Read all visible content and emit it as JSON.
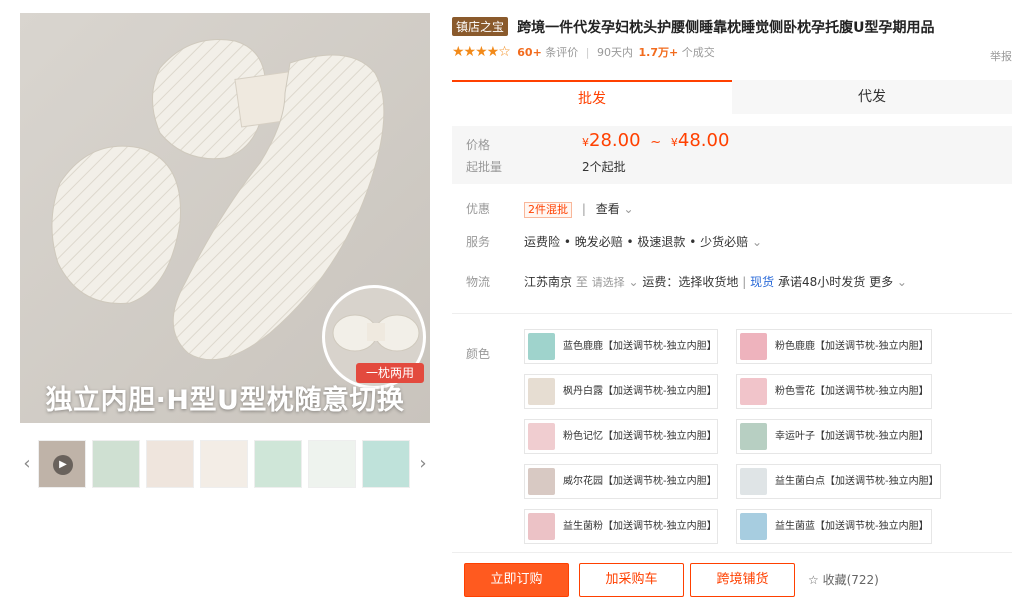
{
  "gallery": {
    "inset_label": "一枕两用",
    "caption": "独立内胆·H型U型枕随意切换",
    "thumbnails": [
      {
        "icon": "video-thumbnail",
        "color": "#bfb3a8"
      },
      {
        "icon": "pillow-thumbnail",
        "color": "#cfe0d2"
      },
      {
        "icon": "pillow-thumbnail",
        "color": "#efe5dd"
      },
      {
        "icon": "pillow-thumbnail",
        "color": "#f3ede6"
      },
      {
        "icon": "pillow-thumbnail",
        "color": "#cfe6d8"
      },
      {
        "icon": "pillow-thumbnail",
        "color": "#eef3ee"
      },
      {
        "icon": "pillow-thumbnail",
        "color": "#bfe2da"
      }
    ]
  },
  "product": {
    "shop_badge": "镇店之宝",
    "title": "跨境一件代发孕妇枕头护腰侧睡靠枕睡觉侧卧枕孕托腹U型孕期用品",
    "rating": {
      "stars": "★★★★☆",
      "reviews_count": "60+",
      "reviews_label": "条评价",
      "period_label": "90天内",
      "sold_count": "1.7万+",
      "sold_label": "个成交"
    },
    "report": "举报"
  },
  "tabs": [
    {
      "label": "批发",
      "active": true
    },
    {
      "label": "代发",
      "active": false
    }
  ],
  "price": {
    "price_label": "价格",
    "currency": "¥",
    "min": "28.00",
    "tilde": "~",
    "max": "48.00",
    "moq_label": "起批量",
    "moq": "2个起批"
  },
  "promo": {
    "label": "优惠",
    "tag": "2件混批",
    "link": "查看"
  },
  "service": {
    "label": "服务",
    "text": "运费险 • 晚发必赔 • 极速退款 • 少货必赔"
  },
  "logistics": {
    "label": "物流",
    "origin": "江苏南京",
    "to": "至",
    "select": "请选择",
    "freight": "运费：选择收货地",
    "stock": "现货",
    "promise": "承诺48小时发货",
    "more": "更多"
  },
  "colors": {
    "label": "颜色",
    "items": [
      {
        "name": "蓝色鹿鹿【加送调节枕-独立内胆】",
        "color": "#9fd3cc"
      },
      {
        "name": "粉色鹿鹿【加送调节枕-独立内胆】",
        "color": "#eeb3bd"
      },
      {
        "name": "枫丹白露【加送调节枕-独立内胆】",
        "color": "#e6ddd2"
      },
      {
        "name": "粉色雪花【加送调节枕-独立内胆】",
        "color": "#f1c4ca"
      },
      {
        "name": "粉色记忆【加送调节枕-独立内胆】",
        "color": "#f0cdd0"
      },
      {
        "name": "幸运叶子【加送调节枕-独立内胆】",
        "color": "#b7cfc2"
      },
      {
        "name": "威尔花园【加送调节枕-独立内胆】",
        "color": "#d8c9c3"
      },
      {
        "name": "益生菌白点【加送调节枕-独立内胆】",
        "color": "#dfe4e6"
      },
      {
        "name": "益生菌粉【加送调节枕-独立内胆】",
        "color": "#ecc2c6"
      },
      {
        "name": "益生菌蓝【加送调节枕-独立内胆】",
        "color": "#a7cde0"
      }
    ]
  },
  "actions": {
    "buy_now": "立即订购",
    "add_cart": "加采购车",
    "cross_border": "跨境铺货",
    "favorite": "收藏(722)"
  },
  "accent_color": "#ff4000"
}
